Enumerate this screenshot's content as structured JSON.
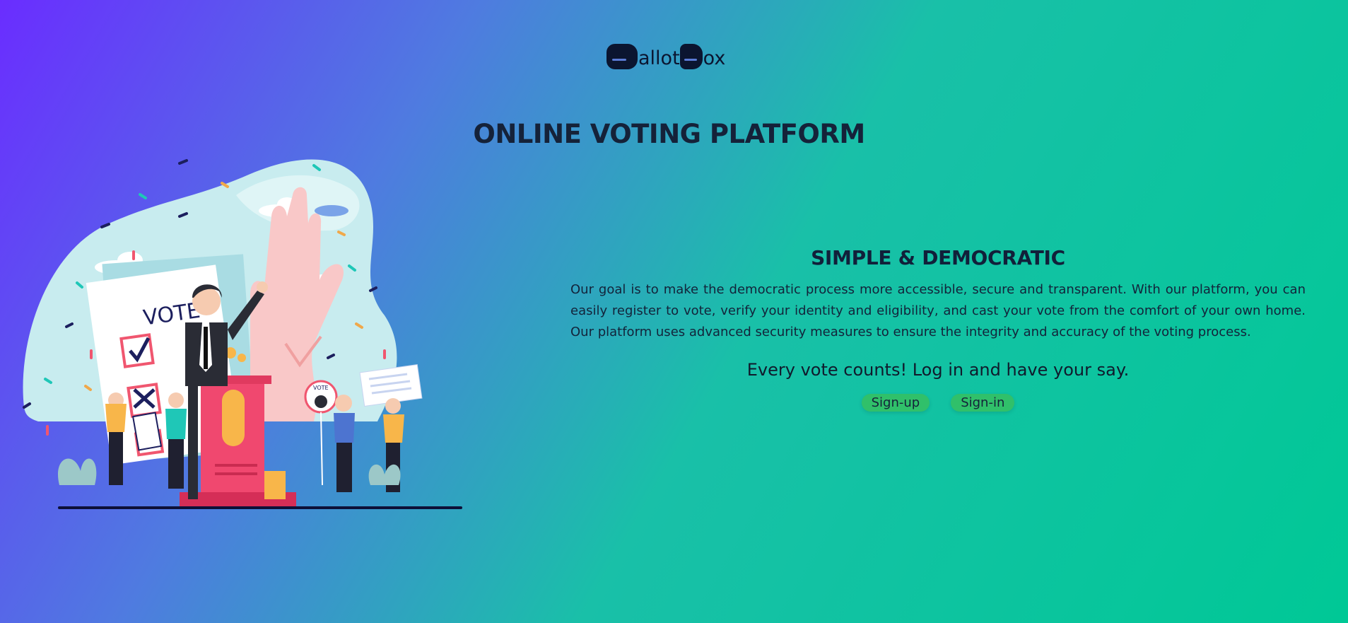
{
  "brand": {
    "logo_text_1": "allot",
    "logo_text_2": "ox"
  },
  "hero": {
    "title": "ONLINE VOTING PLATFORM"
  },
  "illustration": {
    "poster_text": "VOTE",
    "badge_text": "VOTE"
  },
  "section": {
    "heading": "SIMPLE & DEMOCRATIC",
    "description": "Our goal is to make the democratic process more accessible, secure and transparent. With our platform, you can easily register to vote, verify your identity and eligibility, and cast your vote from the comfort of your own home. Our platform uses advanced security measures to ensure the integrity and accuracy of the voting process.",
    "cta": "Every vote counts! Log in and have your say.",
    "signup_label": "Sign-up",
    "signin_label": "Sign-in"
  },
  "colors": {
    "button": "#30c06a",
    "gradient_start": "#6a2dff",
    "gradient_end": "#00c896"
  }
}
